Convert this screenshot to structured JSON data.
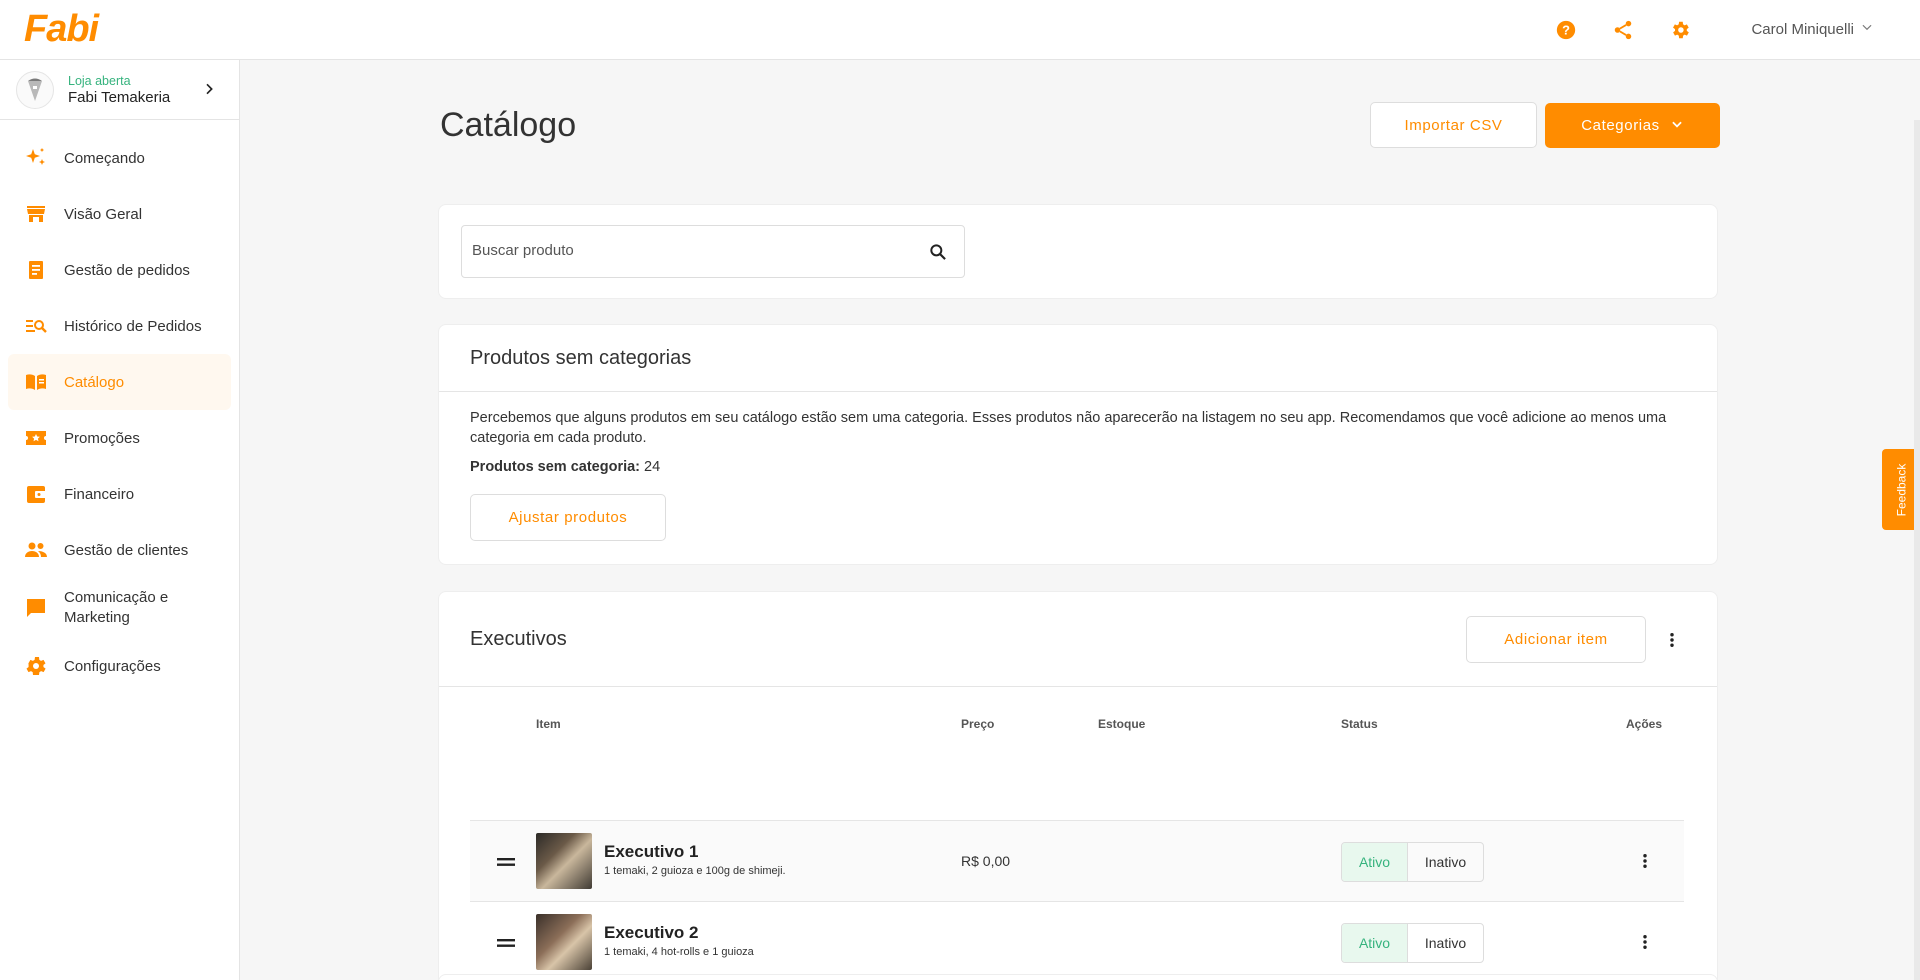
{
  "app": {
    "logo": "Fabi"
  },
  "header": {
    "user_name": "Carol Miniquelli"
  },
  "store": {
    "status": "Loja aberta",
    "name": "Fabi Temakeria"
  },
  "sidebar": {
    "items": [
      {
        "label": "Começando",
        "icon": "sparkles-icon"
      },
      {
        "label": "Visão Geral",
        "icon": "store-icon"
      },
      {
        "label": "Gestão de pedidos",
        "icon": "receipt-icon"
      },
      {
        "label": "Histórico de Pedidos",
        "icon": "search-list-icon"
      },
      {
        "label": "Catálogo",
        "icon": "menu-book-icon",
        "active": true
      },
      {
        "label": "Promoções",
        "icon": "ticket-icon"
      },
      {
        "label": "Financeiro",
        "icon": "wallet-icon"
      },
      {
        "label": "Gestão de clientes",
        "icon": "people-icon"
      },
      {
        "label": "Comunicação e Marketing",
        "icon": "chat-icon"
      },
      {
        "label": "Configurações",
        "icon": "gear-icon"
      }
    ]
  },
  "page": {
    "title": "Catálogo",
    "import_csv": "Importar CSV",
    "categories": "Categorias"
  },
  "search": {
    "placeholder": "Buscar produto",
    "value": ""
  },
  "uncategorized": {
    "title": "Produtos sem categorias",
    "notice": "Percebemos que alguns produtos em seu catálogo estão sem uma categoria. Esses produtos não aparecerão na listagem no seu app. Recomendamos que você adicione ao menos uma categoria em cada produto.",
    "count_label": "Produtos sem categoria:",
    "count_value": "24",
    "adjust_button": "Ajustar produtos"
  },
  "category": {
    "title": "Executivos",
    "add_button": "Adicionar item",
    "columns": {
      "item": "Item",
      "price": "Preço",
      "stock": "Estoque",
      "status": "Status",
      "actions": "Ações"
    },
    "rows": [
      {
        "name": "Executivo 1",
        "desc": "1 temaki, 2 guioza e 100g de shimeji.",
        "price": "R$ 0,00",
        "stock": "",
        "status_on": "Ativo",
        "status_off": "Inativo"
      },
      {
        "name": "Executivo 2",
        "desc": "1 temaki, 4 hot-rolls e 1 guioza",
        "price": "",
        "stock": "",
        "status_on": "Ativo",
        "status_off": "Inativo"
      }
    ]
  },
  "feedback": "Feedback",
  "colors": {
    "accent": "#ff8c00",
    "success": "#36b37e"
  }
}
